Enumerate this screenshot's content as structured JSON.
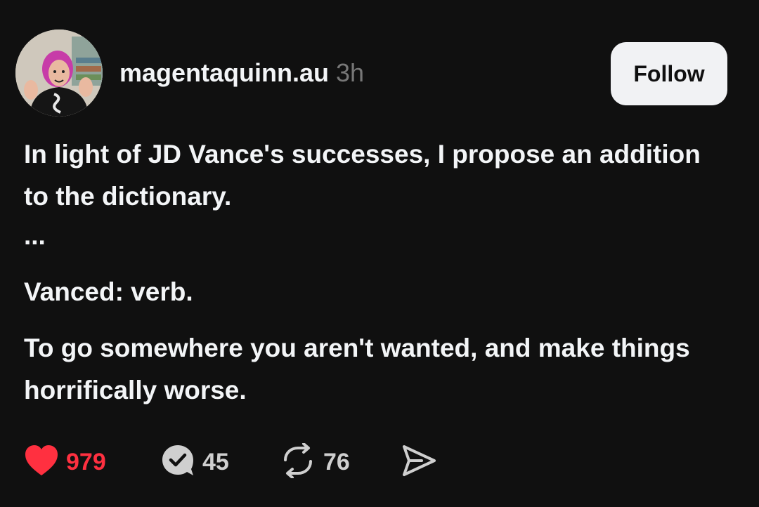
{
  "post": {
    "username": "magentaquinn.au",
    "time": "3h",
    "follow_label": "Follow",
    "paragraphs": [
      "In light of JD Vance's successes, I propose an addition to the dictionary.",
      "...",
      "Vanced: verb.",
      "To go somewhere you aren't wanted, and make things horrifically worse."
    ]
  },
  "actions": {
    "likes": "979",
    "replies": "45",
    "reposts": "76"
  },
  "icons": {
    "like": "heart-icon",
    "reply": "reply-bubble-icon",
    "repost": "repost-icon",
    "share": "share-icon"
  },
  "colors": {
    "background": "#101010",
    "text": "#f3f5f7",
    "muted": "#777777",
    "like_red": "#ff3040",
    "follow_bg": "#f1f2f4"
  }
}
